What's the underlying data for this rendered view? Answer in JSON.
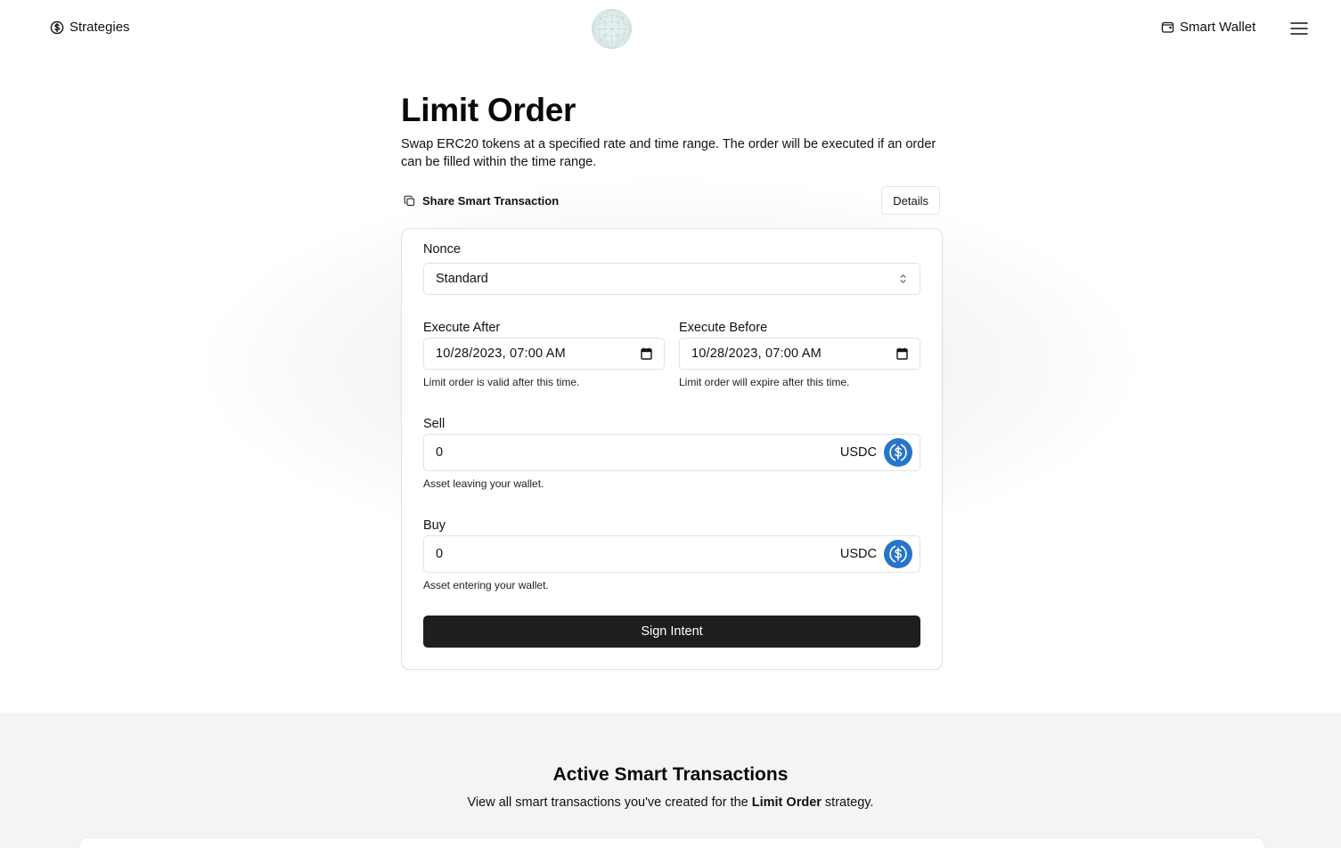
{
  "header": {
    "strategies_label": "Strategies",
    "wallet_label": "Smart Wallet"
  },
  "page": {
    "title": "Limit Order",
    "description": "Swap ERC20 tokens at a specified rate and time range. The order will be executed if an order can be filled within the time range.",
    "share_label": "Share Smart Transaction",
    "details_label": "Details"
  },
  "form": {
    "nonce": {
      "label": "Nonce",
      "value": "Standard"
    },
    "execute_after": {
      "label": "Execute After",
      "value": "10/28/2023, 07:00 AM",
      "hint": "Limit order is valid after this time."
    },
    "execute_before": {
      "label": "Execute Before",
      "value": "10/28/2023, 07:00 AM",
      "hint": "Limit order will expire after this time."
    },
    "sell": {
      "label": "Sell",
      "value": "0",
      "token": "USDC",
      "hint": "Asset leaving your wallet."
    },
    "buy": {
      "label": "Buy",
      "value": "0",
      "token": "USDC",
      "hint": "Asset entering your wallet."
    },
    "submit_label": "Sign Intent"
  },
  "active": {
    "title": "Active Smart Transactions",
    "desc_prefix": "View all smart transactions you've created for the ",
    "desc_strategy": "Limit Order",
    "desc_suffix": " strategy."
  },
  "colors": {
    "usdc_blue": "#2775ca",
    "button_dark": "#1e1e1e",
    "bottom_bg": "#f4f4f4"
  }
}
